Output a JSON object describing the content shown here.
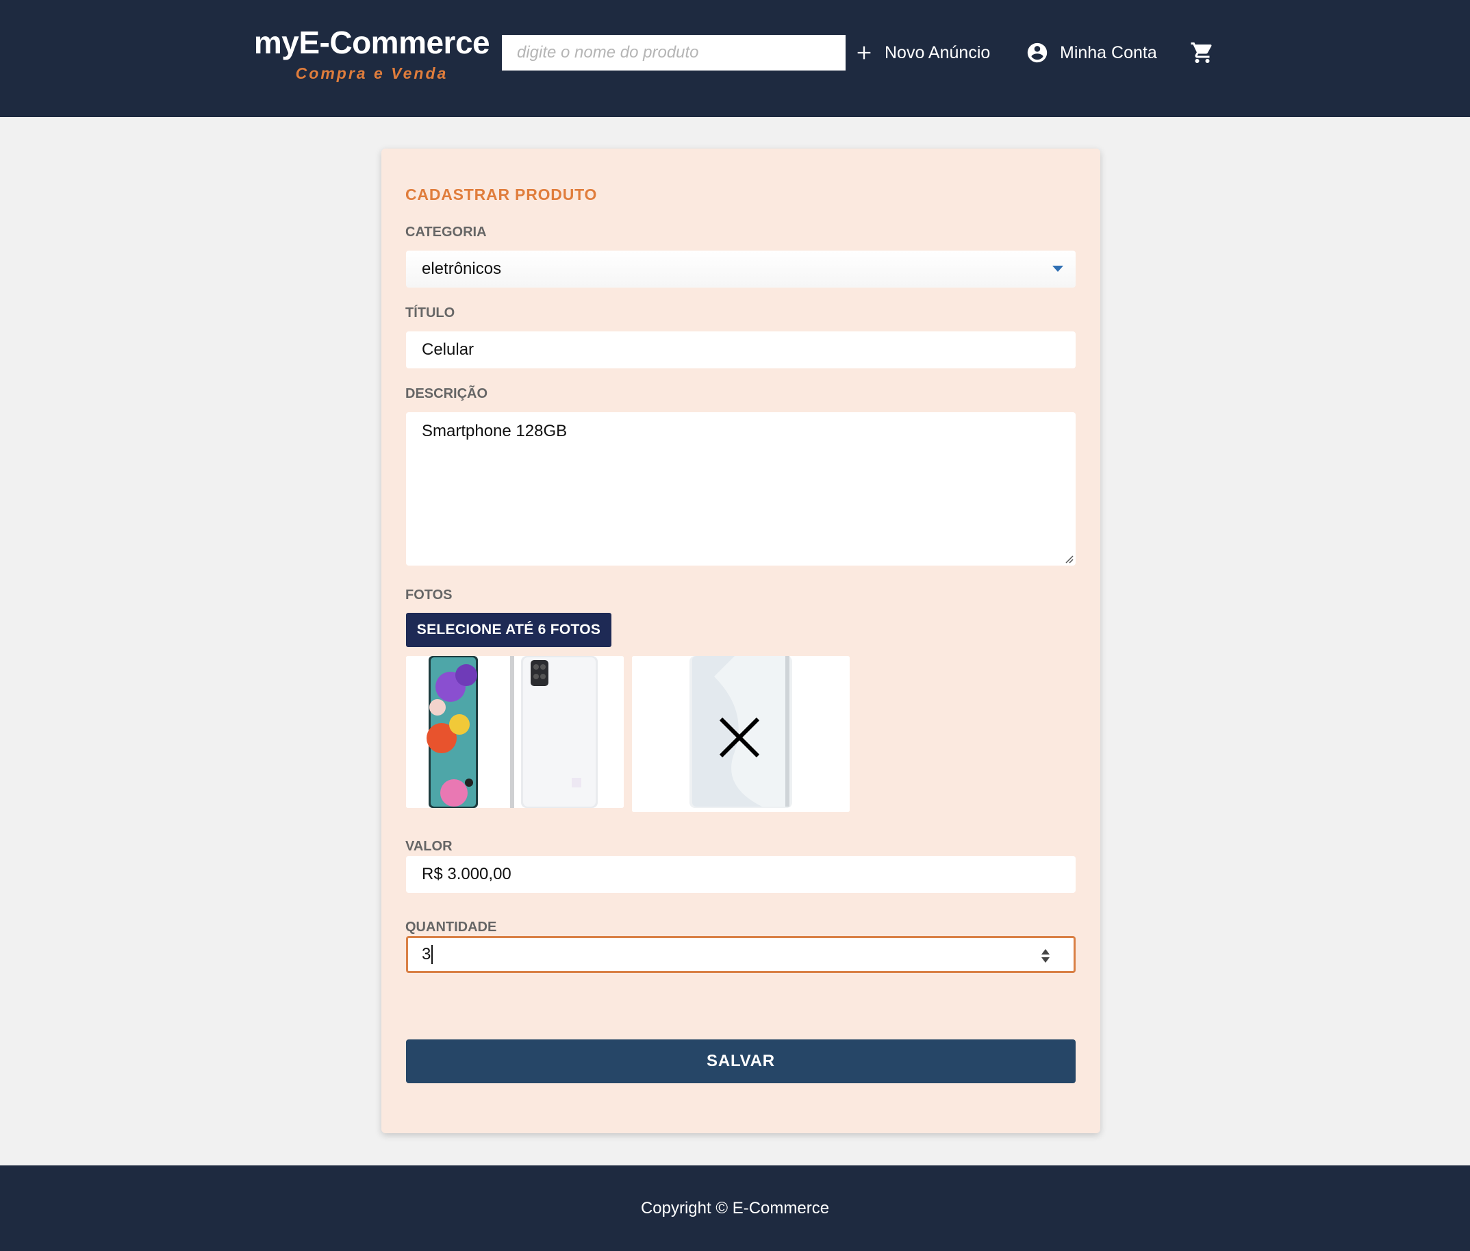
{
  "header": {
    "brand_title": "myE-Commerce",
    "brand_subtitle": "Compra e Venda",
    "search_placeholder": "digite o nome do produto",
    "new_listing_label": "Novo Anúncio",
    "account_label": "Minha Conta",
    "icons": [
      "plus-icon",
      "account-circle-icon",
      "cart-icon"
    ]
  },
  "form": {
    "title": "CADASTRAR PRODUTO",
    "category": {
      "label": "CATEGORIA",
      "value": "eletrônicos"
    },
    "title_field": {
      "label": "TÍTULO",
      "value": "Celular"
    },
    "description": {
      "label": "DESCRIÇÃO",
      "value": "Smartphone 128GB"
    },
    "photos": {
      "label": "FOTOS",
      "button_label": "SELECIONE ATÉ 6 FOTOS",
      "thumbnails": [
        {
          "name": "phone-front-back-photo",
          "state": "normal"
        },
        {
          "name": "phone-back-photo",
          "state": "hover-remove",
          "overlay_icon": "close-icon"
        }
      ]
    },
    "price": {
      "label": "VALOR",
      "value": "R$ 3.000,00"
    },
    "quantity": {
      "label": "QUANTIDADE",
      "value": "3",
      "focused": true
    },
    "save_label": "SALVAR"
  },
  "footer": {
    "copyright": "Copyright © E-Commerce"
  },
  "colors": {
    "header_bg": "#1e2a40",
    "accent": "#e07d3c",
    "card_bg": "#fbe9df",
    "photos_button": "#1e2a55",
    "save_button": "#264667"
  }
}
